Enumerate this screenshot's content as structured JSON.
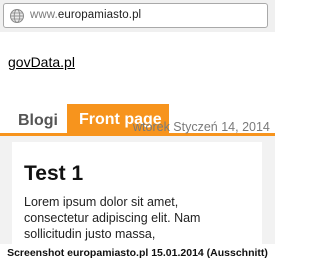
{
  "browser": {
    "url_prefix": "www.",
    "url_domain": "europamiasto.pl",
    "globe_icon": "globe-icon"
  },
  "site": {
    "link_label": "govData.pl"
  },
  "tabs": [
    {
      "label": "Blogi",
      "active": false
    },
    {
      "label": "Front page",
      "active": true
    }
  ],
  "date_line": "wtorek Styczeń 14, 2014",
  "post": {
    "title": "Test 1",
    "body_lines": [
      "Lorem ipsum dolor sit amet,",
      "consectetur adipiscing elit. Nam",
      "sollicitudin justo massa,"
    ]
  },
  "caption": "Screenshot europamiasto.pl 15.01.2014 (Ausschnitt)",
  "colors": {
    "accent": "#f7941d",
    "background": "#f2f2f2"
  }
}
